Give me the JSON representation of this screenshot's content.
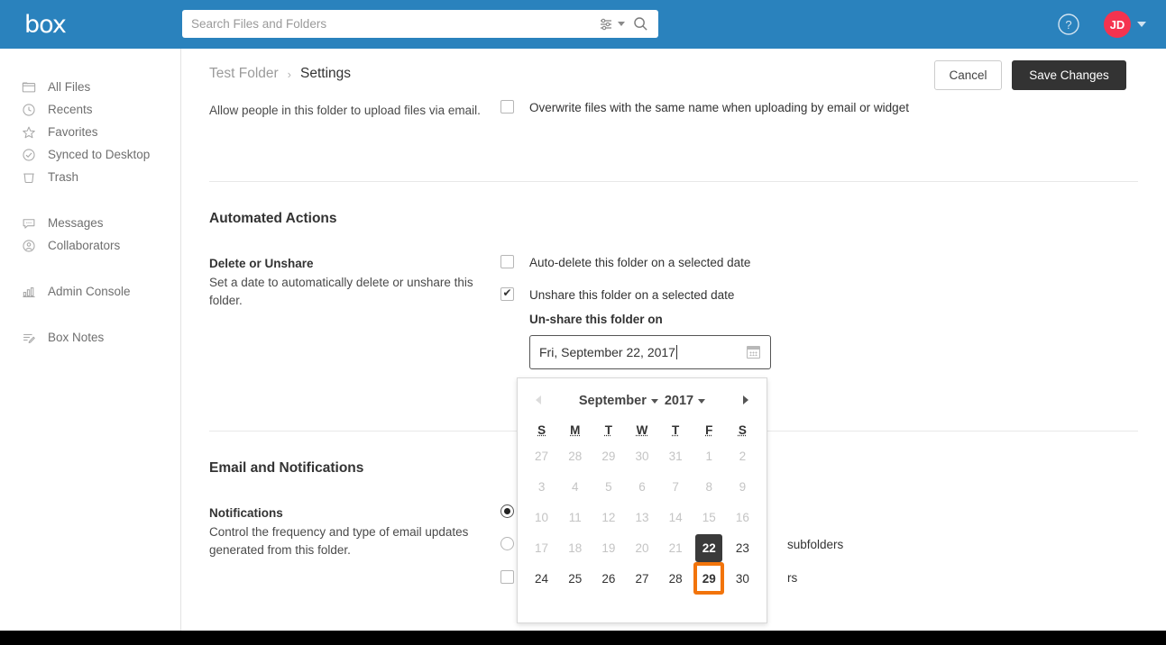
{
  "topbar": {
    "logo": "box",
    "search_placeholder": "Search Files and Folders",
    "search_value": "",
    "search_filter_icon": "sliders-icon",
    "search_icon": "search-icon",
    "help_icon": "help-circle-icon",
    "avatar_initials": "JD",
    "avatar_color": "#f5334f",
    "header_color": "#2a82bd"
  },
  "sidebar": {
    "items": [
      {
        "label": "All Files",
        "icon": "folder-icon"
      },
      {
        "label": "Recents",
        "icon": "clock-icon"
      },
      {
        "label": "Favorites",
        "icon": "star-icon"
      },
      {
        "label": "Synced to Desktop",
        "icon": "check-circle-icon"
      },
      {
        "label": "Trash",
        "icon": "trash-icon"
      },
      {
        "label": "Messages",
        "icon": "message-icon"
      },
      {
        "label": "Collaborators",
        "icon": "person-circle-icon"
      },
      {
        "label": "Admin Console",
        "icon": "bar-chart-icon"
      },
      {
        "label": "Box Notes",
        "icon": "notes-icon"
      }
    ]
  },
  "breadcrumb": {
    "parent": "Test Folder",
    "separator": "›",
    "current": "Settings"
  },
  "toolbar": {
    "cancel_label": "Cancel",
    "save_label": "Save Changes"
  },
  "upload_section": {
    "left_description": "Allow people in this folder to upload files via email.",
    "option_label": "Overwrite files with the same name when uploading by email or widget",
    "option_checked": false
  },
  "automated_actions": {
    "title": "Automated Actions",
    "left_title": "Delete or Unshare",
    "left_description": "Set a date to automatically delete or unshare this folder.",
    "options": [
      {
        "label": "Auto-delete this folder on a selected date",
        "checked": false
      },
      {
        "label": "Unshare this folder on a selected date",
        "checked": true
      }
    ],
    "date_field_label": "Un-share this folder on",
    "date_value": "Fri, September 22, 2017",
    "calendar_icon": "calendar-icon"
  },
  "calendar": {
    "month": "September",
    "year": "2017",
    "prev_icon": "chevron-left-icon",
    "next_icon": "chevron-right-icon",
    "prev_disabled": true,
    "weekdays": [
      "S",
      "M",
      "T",
      "W",
      "T",
      "F",
      "S"
    ],
    "selected_day": 22,
    "focused_day": 29,
    "focus_color": "#f2740b",
    "selected_color": "#3a3a3a",
    "weeks": [
      [
        {
          "n": "27",
          "state": "muted"
        },
        {
          "n": "28",
          "state": "muted"
        },
        {
          "n": "29",
          "state": "muted"
        },
        {
          "n": "30",
          "state": "muted"
        },
        {
          "n": "31",
          "state": "muted"
        },
        {
          "n": "1",
          "state": "muted"
        },
        {
          "n": "2",
          "state": "muted"
        }
      ],
      [
        {
          "n": "3",
          "state": "muted"
        },
        {
          "n": "4",
          "state": "muted"
        },
        {
          "n": "5",
          "state": "muted"
        },
        {
          "n": "6",
          "state": "muted"
        },
        {
          "n": "7",
          "state": "muted"
        },
        {
          "n": "8",
          "state": "muted"
        },
        {
          "n": "9",
          "state": "muted"
        }
      ],
      [
        {
          "n": "10",
          "state": "muted"
        },
        {
          "n": "11",
          "state": "muted"
        },
        {
          "n": "12",
          "state": "muted"
        },
        {
          "n": "13",
          "state": "muted"
        },
        {
          "n": "14",
          "state": "muted"
        },
        {
          "n": "15",
          "state": "muted"
        },
        {
          "n": "16",
          "state": "muted"
        }
      ],
      [
        {
          "n": "17",
          "state": "muted"
        },
        {
          "n": "18",
          "state": "muted"
        },
        {
          "n": "19",
          "state": "muted"
        },
        {
          "n": "20",
          "state": "muted"
        },
        {
          "n": "21",
          "state": "muted"
        },
        {
          "n": "22",
          "state": "selected"
        },
        {
          "n": "23",
          "state": "normal"
        }
      ],
      [
        {
          "n": "24",
          "state": "normal"
        },
        {
          "n": "25",
          "state": "normal"
        },
        {
          "n": "26",
          "state": "normal"
        },
        {
          "n": "27",
          "state": "normal"
        },
        {
          "n": "28",
          "state": "normal"
        },
        {
          "n": "29",
          "state": "focused"
        },
        {
          "n": "30",
          "state": "normal"
        }
      ]
    ]
  },
  "email_notifications": {
    "title": "Email and Notifications",
    "left_title": "Notifications",
    "left_description": "Control the frequency and type of email updates generated from this folder.",
    "options": [
      {
        "type": "radio",
        "label": "",
        "selected": true
      },
      {
        "type": "radio",
        "label": "subfolders",
        "selected": false
      },
      {
        "type": "checkbox",
        "label": "rs",
        "checked": false
      }
    ]
  }
}
